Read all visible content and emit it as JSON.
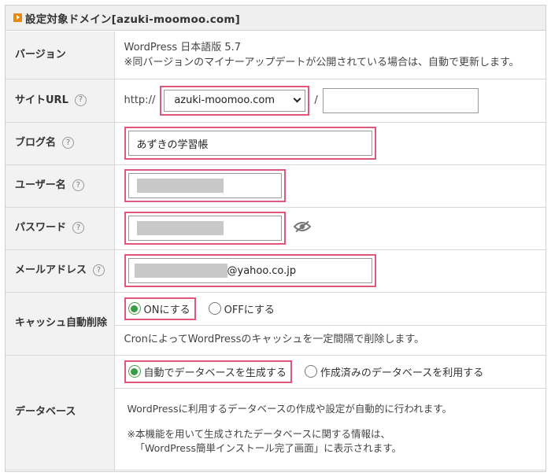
{
  "header": {
    "title": "設定対象ドメイン[azuki-moomoo.com]"
  },
  "fields": {
    "version": {
      "label": "バージョン",
      "line1": "WordPress 日本語版 5.7",
      "line2": "※同バージョンのマイナーアップデートが公開されている場合は、自動で更新します。"
    },
    "site_url": {
      "label": "サイトURL",
      "help": "?",
      "prefix": "http://",
      "domain_selected": "azuki-moomoo.com",
      "separator": "/",
      "subdirectory_value": ""
    },
    "blog_name": {
      "label": "ブログ名",
      "help": "?",
      "value": "あずきの学習帳"
    },
    "username": {
      "label": "ユーザー名",
      "help": "?",
      "value_masked": true
    },
    "password": {
      "label": "パスワード",
      "help": "?",
      "value_masked": true
    },
    "email": {
      "label": "メールアドレス",
      "help": "?",
      "value_suffix": "@yahoo.co.jp"
    },
    "cache": {
      "label": "キャッシュ自動削除",
      "option_on": "ONにする",
      "option_off": "OFFにする",
      "selected": "ON",
      "note": "CronによってWordPressのキャッシュを一定間隔で削除します。"
    },
    "database": {
      "label": "データベース",
      "option_auto": "自動でデータベースを生成する",
      "option_existing": "作成済みのデータベースを利用する",
      "selected": "auto",
      "note1": "WordPressに利用するデータベースの作成や設定が自動的に行われます。",
      "note2": "※本機能を用いて生成されたデータベースに関する情報は、",
      "note3": "「WordPress簡単インストール完了画面」に表示されます。"
    }
  },
  "colors": {
    "highlight": "#e0577c",
    "radio_on": "#3c9b44",
    "label_bg": "#f2f2f2",
    "title_icon": "#e8890f"
  },
  "icons": [
    "play-icon",
    "help-icon",
    "chevron-down-icon",
    "eye-slash-icon"
  ]
}
